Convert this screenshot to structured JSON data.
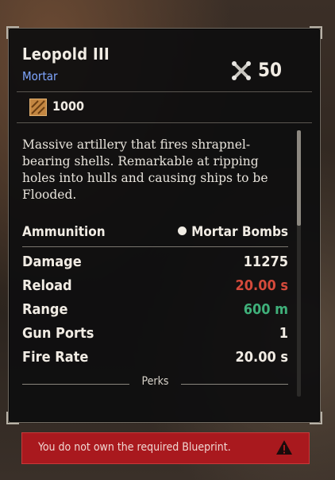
{
  "item": {
    "name": "Leopold III",
    "type": "Mortar",
    "level": "50",
    "cost": "1000",
    "description": "Massive artillery that fires shrapnel-bearing shells. Remarkable at ripping holes into hulls and causing ships to be Flooded."
  },
  "ammunition": {
    "label": "Ammunition",
    "value": "Mortar Bombs"
  },
  "stats": [
    {
      "label": "Damage",
      "value": "11275",
      "color": "#f1ece4"
    },
    {
      "label": "Reload",
      "value": "20.00 s",
      "color": "#d54a3b"
    },
    {
      "label": "Range",
      "value": "600 m",
      "color": "#3fb07a"
    },
    {
      "label": "Gun Ports",
      "value": "1",
      "color": "#f1ece4"
    },
    {
      "label": "Fire Rate",
      "value": "20.00 s",
      "color": "#f1ece4"
    }
  ],
  "perks_label": "Perks",
  "warning": {
    "message": "You do not own the required Blueprint.",
    "icon": "warning-triangle-icon"
  },
  "icons": {
    "level": "crossed-cannons-icon",
    "cost": "resource-crate-icon"
  },
  "colors": {
    "type_accent": "#7fa6ff",
    "warning_bg": "#a9191e"
  }
}
